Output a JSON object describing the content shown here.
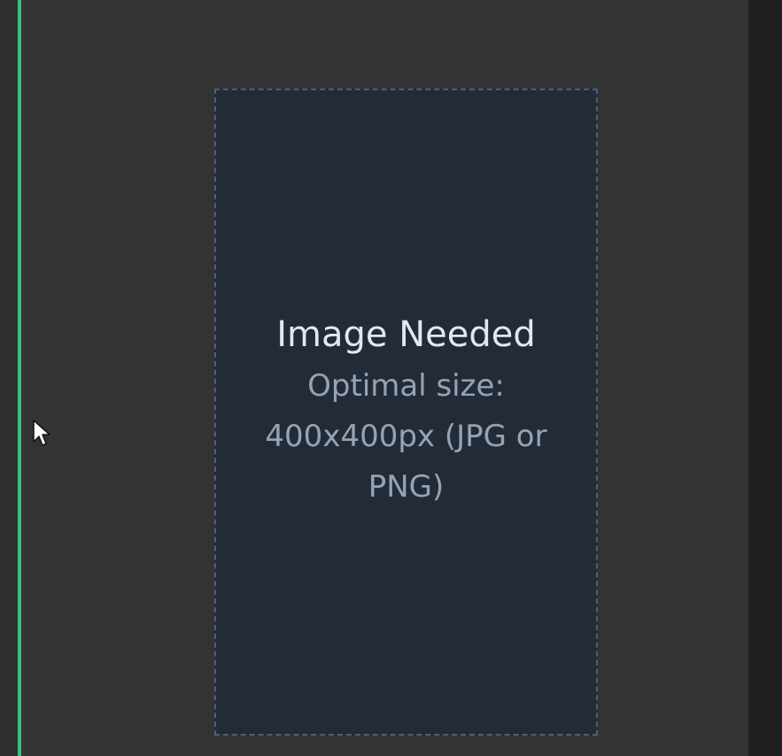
{
  "placeholder": {
    "title": "Image Needed",
    "subtitle": "Optimal size: 400x400px (JPG or PNG)"
  },
  "colors": {
    "accent": "#3cbf74",
    "panel_background": "#333333",
    "placeholder_background": "#232b36",
    "placeholder_border": "#4b607a",
    "title_text": "#e2e8f0",
    "subtitle_text": "#94a3b8"
  },
  "icons": {
    "cursor": "mouse-pointer-icon"
  }
}
